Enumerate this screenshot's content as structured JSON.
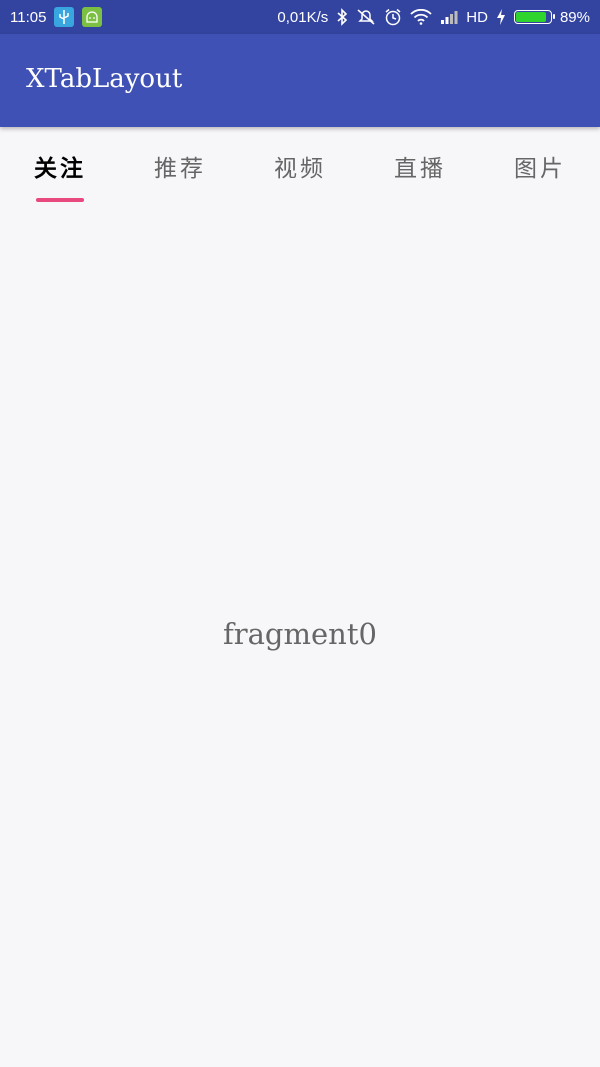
{
  "status_bar": {
    "time": "11:05",
    "network_speed": "0,01K/s",
    "hd_label": "HD",
    "battery_percent": "89%",
    "battery_level": 0.89,
    "icons": [
      "usb-icon",
      "android-debug-icon",
      "bluetooth-icon",
      "mute-icon",
      "alarm-icon",
      "wifi-icon",
      "signal-icon",
      "charging-icon",
      "battery-icon"
    ]
  },
  "app_bar": {
    "title": "XTabLayout"
  },
  "tabs": [
    {
      "label": "关注",
      "selected": true
    },
    {
      "label": "推荐",
      "selected": false
    },
    {
      "label": "视频",
      "selected": false
    },
    {
      "label": "直播",
      "selected": false
    },
    {
      "label": "图片",
      "selected": false
    }
  ],
  "content": {
    "text": "fragment0"
  },
  "colors": {
    "status_bar": "#3344a0",
    "app_bar": "#3f51b5",
    "indicator": "#e84a7f",
    "selected_tab_text": "#000000",
    "unselected_tab_text": "#666666",
    "background": "#f7f6f9"
  }
}
